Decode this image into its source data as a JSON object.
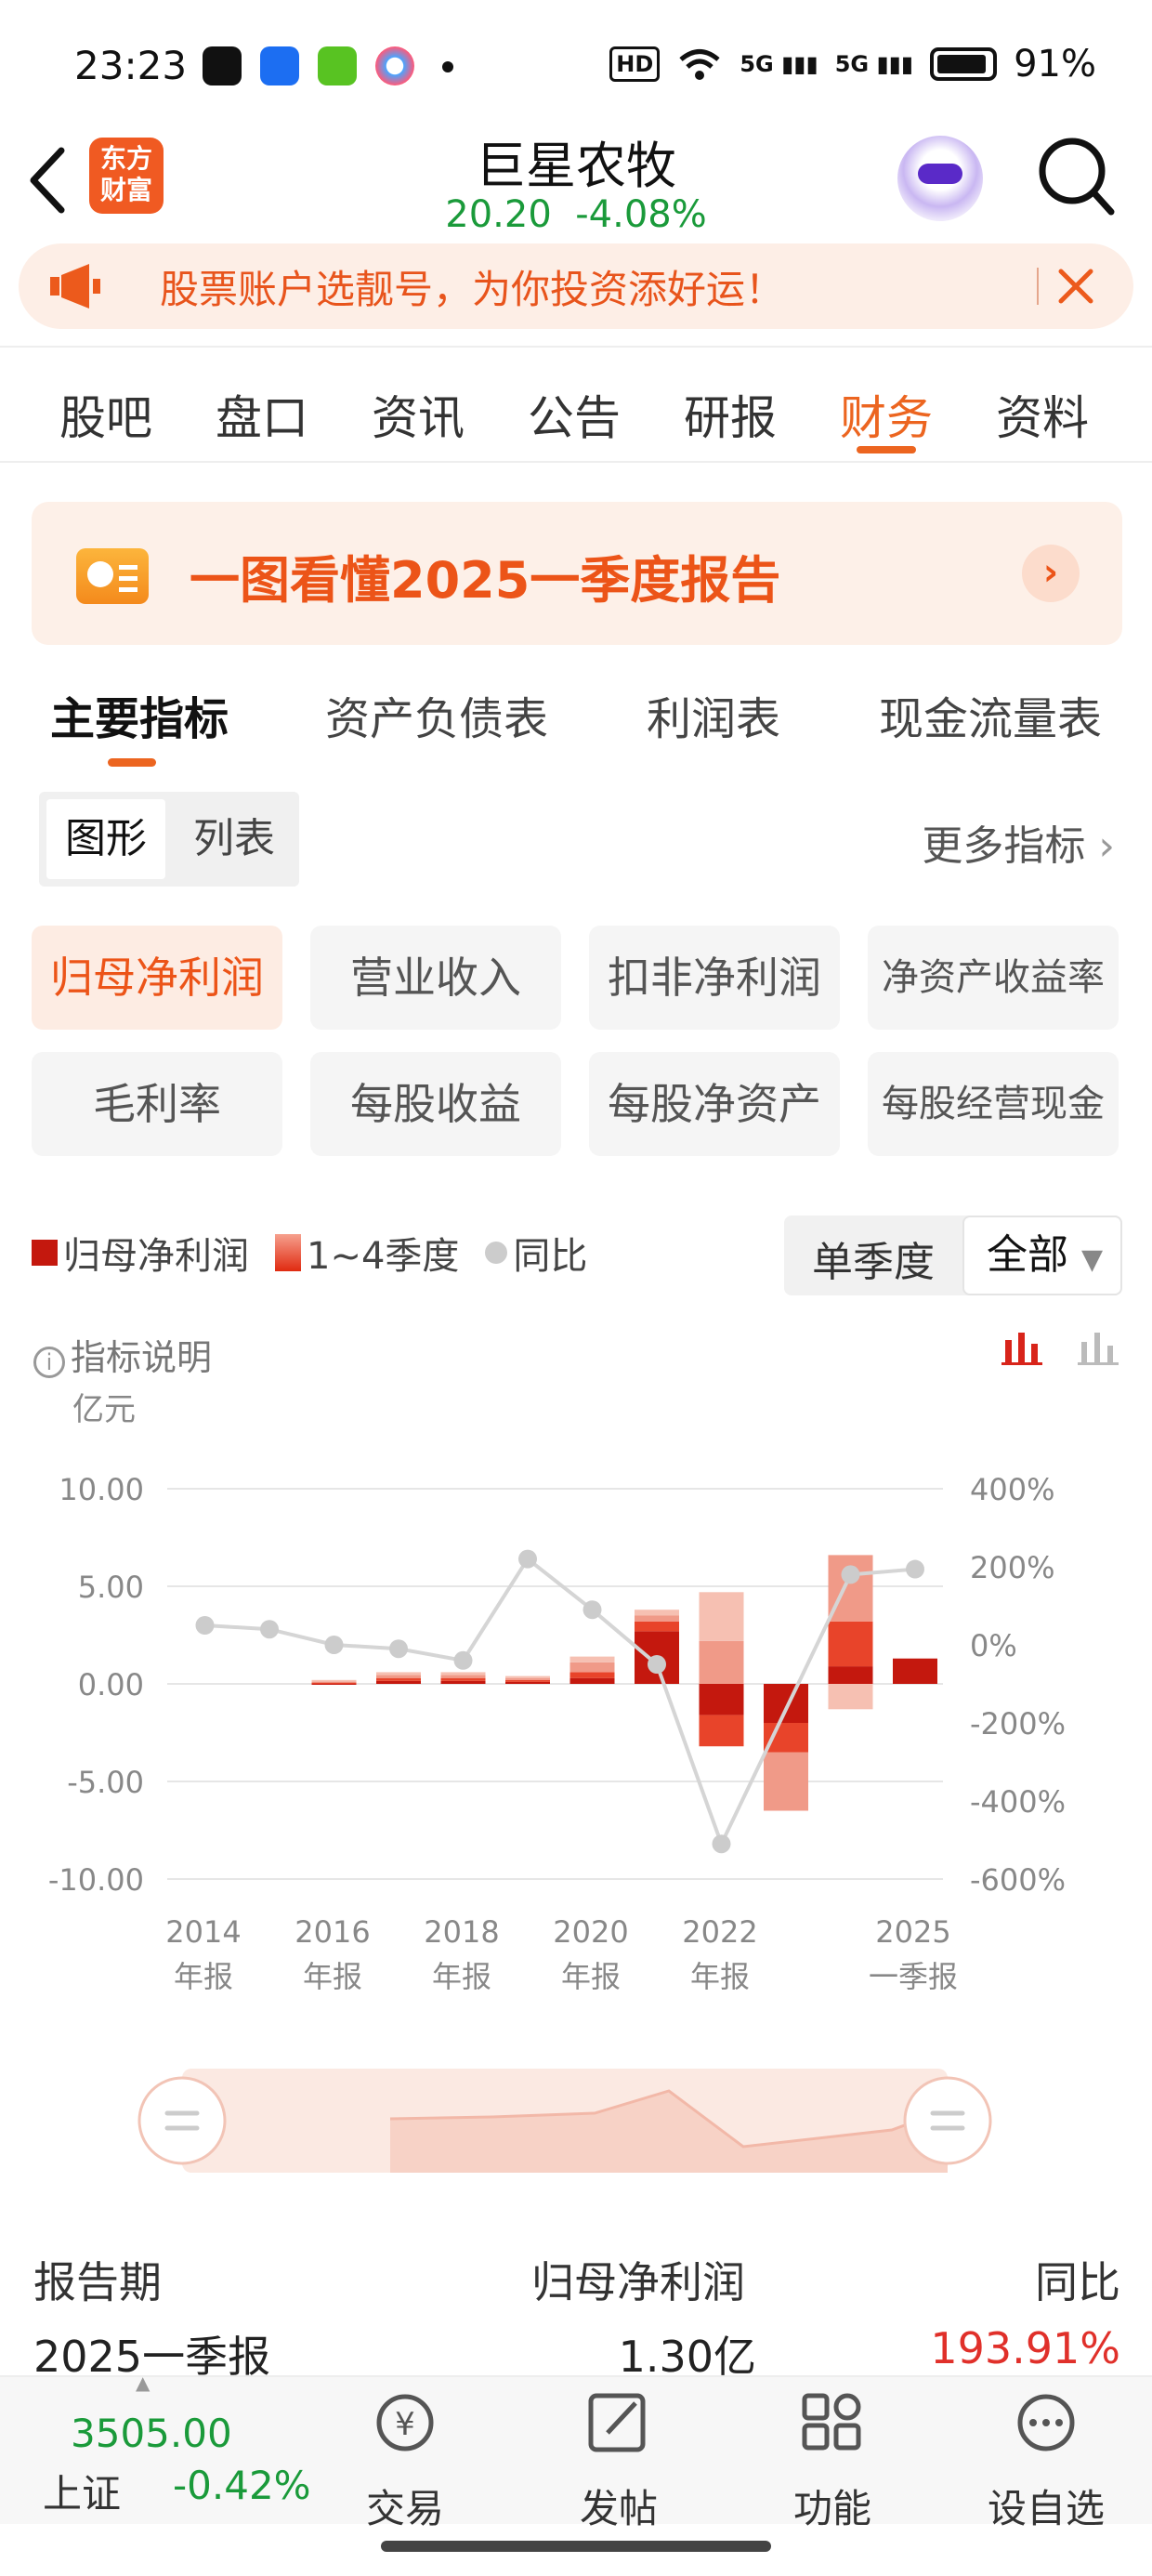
{
  "status_bar": {
    "time": "23:23",
    "signal_1": "5G",
    "signal_2": "5G",
    "battery": "91%",
    "hd": "HD"
  },
  "header": {
    "title": "巨星农牧",
    "price": "20.20",
    "change": "-4.08%",
    "logo_line1": "东方",
    "logo_line2": "财富"
  },
  "banner": {
    "text": "股票账户选靓号，为你投资添好运！"
  },
  "tabs": [
    "股吧",
    "盘口",
    "资讯",
    "公告",
    "研报",
    "财务",
    "资料"
  ],
  "active_tab": "财务",
  "report_card": {
    "text": "一图看懂2025一季度报告"
  },
  "sub_tabs": [
    "主要指标",
    "资产负债表",
    "利润表",
    "现金流量表"
  ],
  "view_toggle": {
    "graph": "图形",
    "list": "列表"
  },
  "more_metrics": "更多指标",
  "metric_chips": [
    "归母净利润",
    "营业收入",
    "扣非净利润",
    "净资产收益率",
    "毛利率",
    "每股收益",
    "每股净资产",
    "每股经营现金"
  ],
  "legend": {
    "series1": "归母净利润",
    "series2": "1~4季度",
    "series3": "同比"
  },
  "period_toggle": {
    "single": "单季度",
    "all": "全部"
  },
  "explain": "指标说明",
  "colors": {
    "accent": "#ec6520",
    "down": "#1a9a3a",
    "up": "#e0302a",
    "bar_dark": "#c4180e",
    "bar_mid": "#e8442a",
    "bar_light": "#f09a88",
    "bar_pale": "#f6c0b2"
  },
  "chart_data": {
    "type": "bar",
    "left_unit": "亿元",
    "left_ticks": [
      "10.00",
      "5.00",
      "0.00",
      "-5.00",
      "-10.00"
    ],
    "right_ticks": [
      "400%",
      "200%",
      "0%",
      "-200%",
      "-400%",
      "-600%"
    ],
    "ylim": [
      -10,
      10
    ],
    "y2lim": [
      -600,
      400
    ],
    "x_labels": [
      [
        "2014",
        "年报"
      ],
      [
        "2016",
        "年报"
      ],
      [
        "2018",
        "年报"
      ],
      [
        "2020",
        "年报"
      ],
      [
        "2022",
        "年报"
      ],
      [
        "2025",
        "一季报"
      ]
    ],
    "categories": [
      "2014年报",
      "2015年报",
      "2016年报",
      "2017年报",
      "2018年报",
      "2019年报",
      "2020年报",
      "2021年报",
      "2022年报",
      "2023年报",
      "2024年报",
      "2025一季报"
    ],
    "stacked_quarters": [
      [
        0,
        0,
        0,
        0
      ],
      [
        0.05,
        0.05,
        0.05,
        0.05
      ],
      [
        0.15,
        0.15,
        0.15,
        0.15
      ],
      [
        0.15,
        0.15,
        0.15,
        0.15
      ],
      [
        0.1,
        0.1,
        0.1,
        0.1
      ],
      [
        0.3,
        0.3,
        0.5,
        0.3
      ],
      [
        2.7,
        0.5,
        0.3,
        0.3
      ],
      [
        -1.6,
        -1.6,
        2.2,
        2.5
      ],
      [
        -2.0,
        -1.5,
        -3.0,
        0
      ],
      [
        0.9,
        2.3,
        3.4,
        -1.3
      ],
      [
        1.3,
        0,
        0,
        0
      ]
    ],
    "yoy_series": [
      {
        "x": "2014年报",
        "value": 50
      },
      {
        "x": "2015年报",
        "value": 40
      },
      {
        "x": "2016年报",
        "value": 0
      },
      {
        "x": "2017年报",
        "value": -10
      },
      {
        "x": "2018年报",
        "value": -40
      },
      {
        "x": "2019年报",
        "value": 220
      },
      {
        "x": "2020年报",
        "value": 90
      },
      {
        "x": "2021年报",
        "value": -50
      },
      {
        "x": "2022年报",
        "value": -510
      },
      {
        "x": "2024年报",
        "value": 180
      },
      {
        "x": "2025一季报",
        "value": 193.91
      }
    ]
  },
  "table": {
    "headers": [
      "报告期",
      "归母净利润",
      "同比"
    ],
    "rows": [
      [
        "2025一季报",
        "1.30亿",
        "193.91%"
      ]
    ]
  },
  "bottom_nav": {
    "index_value": "3505.00",
    "index_name": "上证",
    "index_change": "-0.42%",
    "items": [
      "交易",
      "发帖",
      "功能",
      "设自选"
    ]
  }
}
